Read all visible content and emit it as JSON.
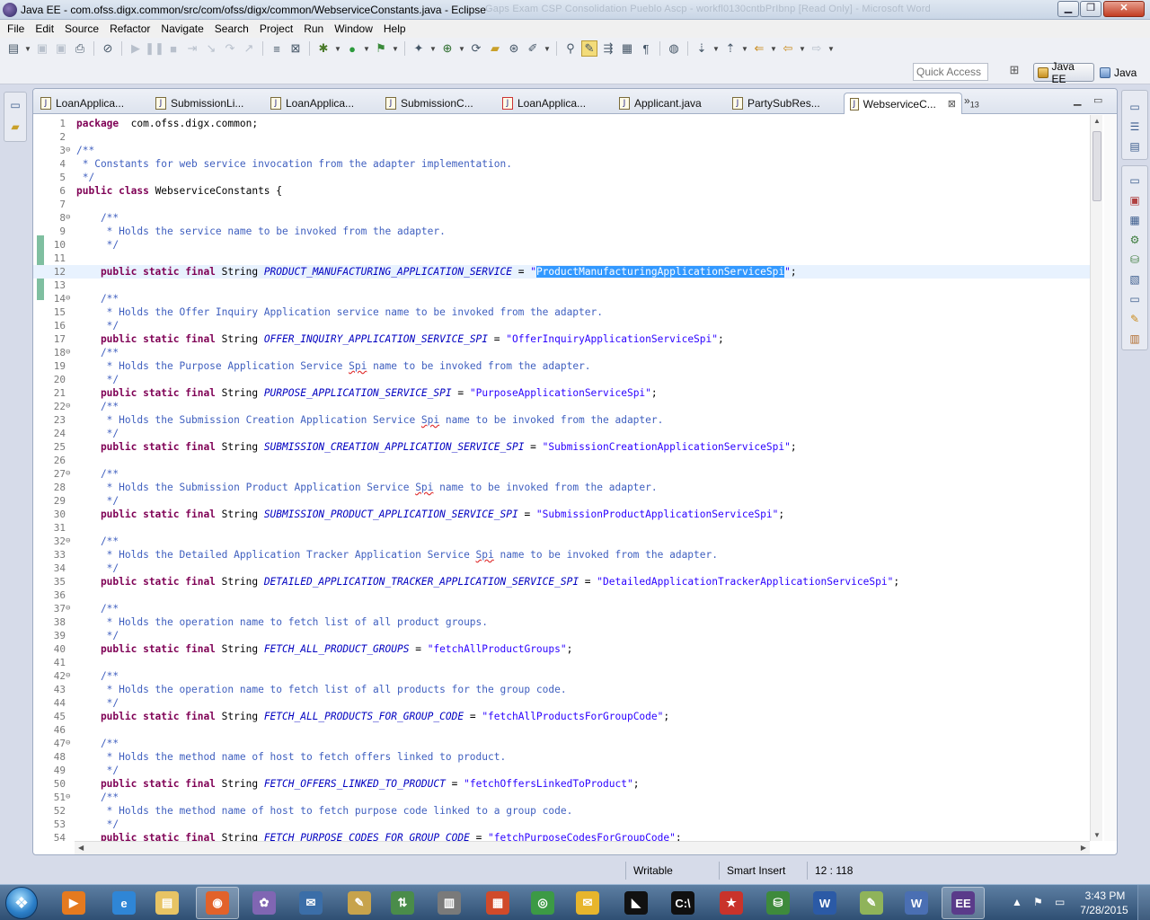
{
  "window": {
    "title": "Java EE - com.ofss.digx.common/src/com/ofss/digx/common/WebserviceConstants.java - Eclipse",
    "ghost_text": "Gaps Exam          CSP Consolidation  Pueblo Ascp - workfl0130cntbPrIbnp [Read Only] - Microsoft Word"
  },
  "menu": [
    "File",
    "Edit",
    "Source",
    "Refactor",
    "Navigate",
    "Search",
    "Project",
    "Run",
    "Window",
    "Help"
  ],
  "quick_access": {
    "placeholder": "Quick Access"
  },
  "perspectives": {
    "active": "Java EE",
    "other": "Java"
  },
  "tabs": [
    {
      "label": "LoanApplica...",
      "icon": "java-file-icon",
      "error": false
    },
    {
      "label": "SubmissionLi...",
      "icon": "java-file-icon",
      "error": false
    },
    {
      "label": "LoanApplica...",
      "icon": "java-file-icon",
      "error": false
    },
    {
      "label": "SubmissionC...",
      "icon": "java-file-icon",
      "error": false
    },
    {
      "label": "LoanApplica...",
      "icon": "java-file-icon",
      "error": true
    },
    {
      "label": "Applicant.java",
      "icon": "java-file-icon",
      "error": false
    },
    {
      "label": "PartySubRes...",
      "icon": "java-file-icon",
      "error": false
    },
    {
      "label": "WebserviceC...",
      "icon": "java-file-icon",
      "error": false,
      "active": true
    }
  ],
  "tab_overflow": {
    "symbol": "»",
    "count": "13"
  },
  "code_lines": [
    {
      "n": 1,
      "parts": [
        [
          "kw",
          "package"
        ],
        [
          "",
          "  com.ofss.digx.common;"
        ]
      ]
    },
    {
      "n": 2,
      "parts": []
    },
    {
      "n": 3,
      "fold": "⊖",
      "parts": [
        [
          "cm",
          "/**"
        ]
      ]
    },
    {
      "n": 4,
      "parts": [
        [
          "cm",
          " * Constants for web service invocation from the adapter implementation."
        ]
      ]
    },
    {
      "n": 5,
      "parts": [
        [
          "cm",
          " */"
        ]
      ]
    },
    {
      "n": 6,
      "parts": [
        [
          "kw",
          "public class"
        ],
        [
          "",
          " WebserviceConstants {"
        ]
      ]
    },
    {
      "n": 7,
      "parts": []
    },
    {
      "n": 8,
      "fold": "⊖",
      "parts": [
        [
          "cm",
          "    /**"
        ]
      ]
    },
    {
      "n": 9,
      "parts": [
        [
          "cm",
          "     * Holds the service name to be invoked from the adapter."
        ]
      ]
    },
    {
      "n": 10,
      "parts": [
        [
          "cm",
          "     */"
        ]
      ]
    },
    {
      "n": 11,
      "parts": []
    },
    {
      "n": 12,
      "current": true,
      "parts": [
        [
          "kw",
          "    public static final"
        ],
        [
          "",
          " String "
        ],
        [
          "const",
          "PRODUCT_MANUFACTURING_APPLICATION_SERVICE"
        ],
        [
          "",
          " = "
        ],
        [
          "str",
          "\""
        ],
        [
          "sel",
          "ProductManufacturingApplicationServiceSpi"
        ],
        [
          "str",
          "\""
        ],
        [
          "",
          ";"
        ]
      ]
    },
    {
      "n": 13,
      "parts": []
    },
    {
      "n": 14,
      "fold": "⊖",
      "parts": [
        [
          "cm",
          "    /**"
        ]
      ]
    },
    {
      "n": 15,
      "parts": [
        [
          "cm",
          "     * Holds the Offer Inquiry Application service name to be invoked from the adapter."
        ]
      ]
    },
    {
      "n": 16,
      "parts": [
        [
          "cm",
          "     */"
        ]
      ]
    },
    {
      "n": 17,
      "parts": [
        [
          "kw",
          "    public static final"
        ],
        [
          "",
          " String "
        ],
        [
          "const",
          "OFFER_INQUIRY_APPLICATION_SERVICE_SPI"
        ],
        [
          "",
          " = "
        ],
        [
          "str",
          "\"OfferInquiryApplicationServiceSpi\""
        ],
        [
          "",
          ";"
        ]
      ]
    },
    {
      "n": 18,
      "fold": "⊖",
      "parts": [
        [
          "cm",
          "    /**"
        ]
      ]
    },
    {
      "n": 19,
      "parts": [
        [
          "cm",
          "     * Holds the Purpose Application Service "
        ],
        [
          "cm squig",
          "Spi"
        ],
        [
          "cm",
          " name to be invoked from the adapter."
        ]
      ]
    },
    {
      "n": 20,
      "parts": [
        [
          "cm",
          "     */"
        ]
      ]
    },
    {
      "n": 21,
      "parts": [
        [
          "kw",
          "    public static final"
        ],
        [
          "",
          " String "
        ],
        [
          "const",
          "PURPOSE_APPLICATION_SERVICE_SPI"
        ],
        [
          "",
          " = "
        ],
        [
          "str",
          "\"PurposeApplicationServiceSpi\""
        ],
        [
          "",
          ";"
        ]
      ]
    },
    {
      "n": 22,
      "fold": "⊖",
      "parts": [
        [
          "cm",
          "    /**"
        ]
      ]
    },
    {
      "n": 23,
      "parts": [
        [
          "cm",
          "     * Holds the Submission Creation Application Service "
        ],
        [
          "cm squig",
          "Spi"
        ],
        [
          "cm",
          " name to be invoked from the adapter."
        ]
      ]
    },
    {
      "n": 24,
      "parts": [
        [
          "cm",
          "     */"
        ]
      ]
    },
    {
      "n": 25,
      "parts": [
        [
          "kw",
          "    public static final"
        ],
        [
          "",
          " String "
        ],
        [
          "const",
          "SUBMISSION_CREATION_APPLICATION_SERVICE_SPI"
        ],
        [
          "",
          " = "
        ],
        [
          "str",
          "\"SubmissionCreationApplicationServiceSpi\""
        ],
        [
          "",
          ";"
        ]
      ]
    },
    {
      "n": 26,
      "parts": []
    },
    {
      "n": 27,
      "fold": "⊖",
      "parts": [
        [
          "cm",
          "    /**"
        ]
      ]
    },
    {
      "n": 28,
      "parts": [
        [
          "cm",
          "     * Holds the Submission Product Application Service "
        ],
        [
          "cm squig",
          "Spi"
        ],
        [
          "cm",
          " name to be invoked from the adapter."
        ]
      ]
    },
    {
      "n": 29,
      "parts": [
        [
          "cm",
          "     */"
        ]
      ]
    },
    {
      "n": 30,
      "parts": [
        [
          "kw",
          "    public static final"
        ],
        [
          "",
          " String "
        ],
        [
          "const",
          "SUBMISSION_PRODUCT_APPLICATION_SERVICE_SPI"
        ],
        [
          "",
          " = "
        ],
        [
          "str",
          "\"SubmissionProductApplicationServiceSpi\""
        ],
        [
          "",
          ";"
        ]
      ]
    },
    {
      "n": 31,
      "parts": []
    },
    {
      "n": 32,
      "fold": "⊖",
      "parts": [
        [
          "cm",
          "    /**"
        ]
      ]
    },
    {
      "n": 33,
      "parts": [
        [
          "cm",
          "     * Holds the Detailed Application Tracker Application Service "
        ],
        [
          "cm squig",
          "Spi"
        ],
        [
          "cm",
          " name to be invoked from the adapter."
        ]
      ]
    },
    {
      "n": 34,
      "parts": [
        [
          "cm",
          "     */"
        ]
      ]
    },
    {
      "n": 35,
      "parts": [
        [
          "kw",
          "    public static final"
        ],
        [
          "",
          " String "
        ],
        [
          "const",
          "DETAILED_APPLICATION_TRACKER_APPLICATION_SERVICE_SPI"
        ],
        [
          "",
          " = "
        ],
        [
          "str",
          "\"DetailedApplicationTrackerApplicationServiceSpi\""
        ],
        [
          "",
          ";"
        ]
      ]
    },
    {
      "n": 36,
      "parts": []
    },
    {
      "n": 37,
      "fold": "⊖",
      "parts": [
        [
          "cm",
          "    /**"
        ]
      ]
    },
    {
      "n": 38,
      "parts": [
        [
          "cm",
          "     * Holds the operation name to fetch list of all product groups."
        ]
      ]
    },
    {
      "n": 39,
      "parts": [
        [
          "cm",
          "     */"
        ]
      ]
    },
    {
      "n": 40,
      "parts": [
        [
          "kw",
          "    public static final"
        ],
        [
          "",
          " String "
        ],
        [
          "const",
          "FETCH_ALL_PRODUCT_GROUPS"
        ],
        [
          "",
          " = "
        ],
        [
          "str",
          "\"fetchAllProductGroups\""
        ],
        [
          "",
          ";"
        ]
      ]
    },
    {
      "n": 41,
      "parts": []
    },
    {
      "n": 42,
      "fold": "⊖",
      "parts": [
        [
          "cm",
          "    /**"
        ]
      ]
    },
    {
      "n": 43,
      "parts": [
        [
          "cm",
          "     * Holds the operation name to fetch list of all products for the group code."
        ]
      ]
    },
    {
      "n": 44,
      "parts": [
        [
          "cm",
          "     */"
        ]
      ]
    },
    {
      "n": 45,
      "parts": [
        [
          "kw",
          "    public static final"
        ],
        [
          "",
          " String "
        ],
        [
          "const",
          "FETCH_ALL_PRODUCTS_FOR_GROUP_CODE"
        ],
        [
          "",
          " = "
        ],
        [
          "str",
          "\"fetchAllProductsForGroupCode\""
        ],
        [
          "",
          ";"
        ]
      ]
    },
    {
      "n": 46,
      "parts": []
    },
    {
      "n": 47,
      "fold": "⊖",
      "parts": [
        [
          "cm",
          "    /**"
        ]
      ]
    },
    {
      "n": 48,
      "parts": [
        [
          "cm",
          "     * Holds the method name of host to fetch offers linked to product."
        ]
      ]
    },
    {
      "n": 49,
      "parts": [
        [
          "cm",
          "     */"
        ]
      ]
    },
    {
      "n": 50,
      "parts": [
        [
          "kw",
          "    public static final"
        ],
        [
          "",
          " String "
        ],
        [
          "const",
          "FETCH_OFFERS_LINKED_TO_PRODUCT"
        ],
        [
          "",
          " = "
        ],
        [
          "str",
          "\"fetchOffersLinkedToProduct\""
        ],
        [
          "",
          ";"
        ]
      ]
    },
    {
      "n": 51,
      "fold": "⊖",
      "parts": [
        [
          "cm",
          "    /**"
        ]
      ]
    },
    {
      "n": 52,
      "parts": [
        [
          "cm",
          "     * Holds the method name of host to fetch purpose code linked to a group code."
        ]
      ]
    },
    {
      "n": 53,
      "parts": [
        [
          "cm",
          "     */"
        ]
      ]
    },
    {
      "n": 54,
      "parts": [
        [
          "kw",
          "    public static final"
        ],
        [
          "",
          " String "
        ],
        [
          "const",
          "FETCH_PURPOSE_CODES_FOR_GROUP_CODE"
        ],
        [
          "",
          " = "
        ],
        [
          "str",
          "\"fetchPurposeCodesForGroupCode\""
        ],
        [
          "",
          ";"
        ]
      ]
    }
  ],
  "status": {
    "writable": "Writable",
    "insert_mode": "Smart Insert",
    "cursor_position": "12 : 118"
  },
  "taskbar": {
    "apps": [
      {
        "name": "media-player-icon",
        "glyph": "▶",
        "color": "#e57a1f"
      },
      {
        "name": "internet-explorer-icon",
        "glyph": "e",
        "color": "#2f86d6"
      },
      {
        "name": "file-explorer-icon",
        "glyph": "▤",
        "color": "#e8c464"
      },
      {
        "name": "firefox-icon",
        "glyph": "◉",
        "color": "#e2622a",
        "active": true
      },
      {
        "name": "pidgin-icon",
        "glyph": "✿",
        "color": "#8066b3"
      },
      {
        "name": "thunderbird-icon",
        "glyph": "✉",
        "color": "#3b6ea8"
      },
      {
        "name": "paint-icon",
        "glyph": "✎",
        "color": "#c7a34c"
      },
      {
        "name": "network-icon",
        "glyph": "⇅",
        "color": "#4a8c4a"
      },
      {
        "name": "archive-icon",
        "glyph": "▥",
        "color": "#7a7a7a"
      },
      {
        "name": "app-grid-icon",
        "glyph": "▦",
        "color": "#d04a2a"
      },
      {
        "name": "chrome-icon",
        "glyph": "◎",
        "color": "#3c9a45"
      },
      {
        "name": "outlook-icon",
        "glyph": "✉",
        "color": "#e7b52c"
      },
      {
        "name": "terminal-game-icon",
        "glyph": "◣",
        "color": "#111111"
      },
      {
        "name": "command-prompt-icon",
        "glyph": "C:\\",
        "color": "#101010"
      },
      {
        "name": "star-app-icon",
        "glyph": "★",
        "color": "#c9332b"
      },
      {
        "name": "database-icon",
        "glyph": "⛁",
        "color": "#3e8a3c"
      },
      {
        "name": "word-icon",
        "glyph": "W",
        "color": "#2b5aa6"
      },
      {
        "name": "notepad-plus-icon",
        "glyph": "✎",
        "color": "#8fb35a"
      },
      {
        "name": "word-doc-icon",
        "glyph": "W",
        "color": "#4a6fb3"
      },
      {
        "name": "eclipse-javaee-icon",
        "glyph": "EE",
        "color": "#5a3b8a",
        "active": true
      }
    ],
    "clock_time": "3:43 PM",
    "clock_date": "7/28/2015"
  }
}
